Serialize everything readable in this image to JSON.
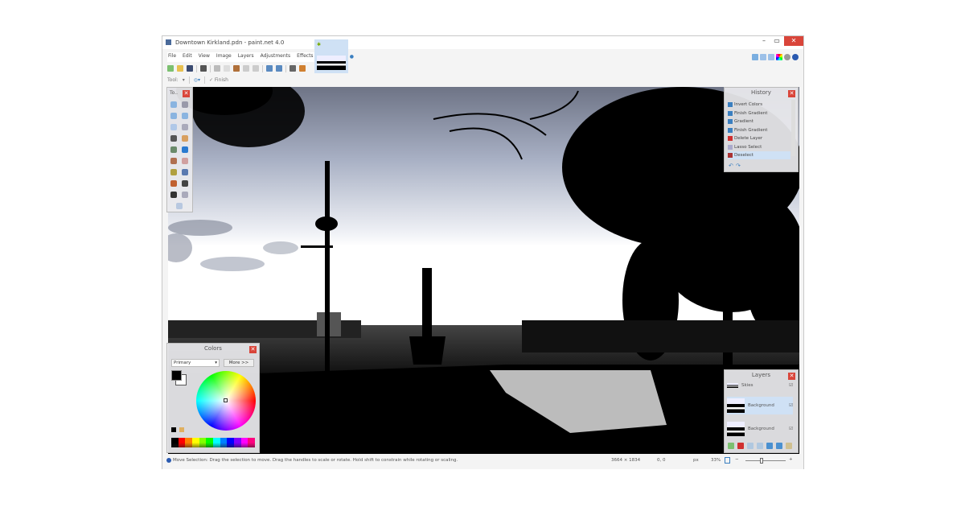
{
  "window": {
    "title": "Downtown Kirkland.pdn - paint.net 4.0",
    "minimize": "–",
    "maximize": "▭",
    "close": "✕"
  },
  "menu": [
    "File",
    "Edit",
    "View",
    "Image",
    "Layers",
    "Adjustments",
    "Effects"
  ],
  "toolbar2": {
    "tool_label": "Tool:",
    "finish": "✓ Finish"
  },
  "tools_panel": {
    "title": "To..",
    "close": "✕"
  },
  "history": {
    "title": "History",
    "close": "✕",
    "items": [
      {
        "label": "Invert Colors",
        "icon": "gradient-icon"
      },
      {
        "label": "Finish Gradient",
        "icon": "gradient-icon"
      },
      {
        "label": "Gradient",
        "icon": "gradient-icon"
      },
      {
        "label": "Finish Gradient",
        "icon": "gradient-icon"
      },
      {
        "label": "Delete Layer",
        "icon": "delete-icon"
      },
      {
        "label": "Lasso Select",
        "icon": "lasso-icon"
      },
      {
        "label": "Deselect",
        "icon": "deselect-icon",
        "selected": true
      }
    ],
    "undo": "↶",
    "redo": "↷"
  },
  "layers": {
    "title": "Layers",
    "close": "✕",
    "items": [
      {
        "name": "Skies",
        "checked": true
      },
      {
        "name": "Background",
        "checked": true,
        "selected": true
      },
      {
        "name": "Background",
        "checked": true
      }
    ]
  },
  "colors": {
    "title": "Colors",
    "close": "✕",
    "mode": "Primary",
    "more_button": "More >>",
    "primary": "#000000",
    "secondary": "#ffffff",
    "palette": [
      "#000000",
      "#ff0000",
      "#ff8000",
      "#ffff00",
      "#80ff00",
      "#00ff00",
      "#00ffff",
      "#0080ff",
      "#0000ff",
      "#8000ff",
      "#ff00ff",
      "#ff0080"
    ]
  },
  "status": {
    "message": "Move Selection: Drag the selection to move. Drag the handles to scale or rotate. Hold shift to constrain while rotating or scaling.",
    "size": "3664 × 1834",
    "selection": "0, 0",
    "units": "px",
    "zoom": "33%"
  },
  "colors_accent": {
    "close_red": "#d9453a",
    "selection_blue": "#cfe1f5"
  }
}
